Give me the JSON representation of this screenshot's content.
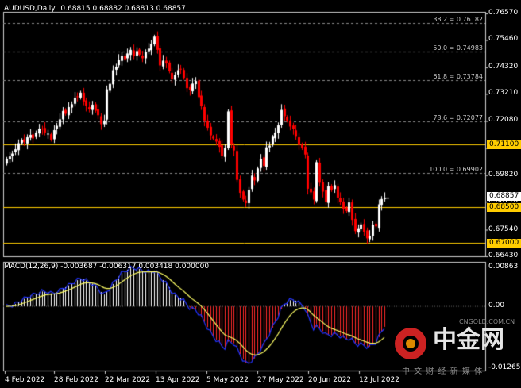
{
  "header": {
    "symbol": "AUDUSD,Daily",
    "ohlc": "0.68815 0.68882 0.68813 0.68857"
  },
  "macd": {
    "label": "MACD(12,26,9) -0.003687 -0.006317 0.003418 0.000000",
    "axis": [
      "0.00863",
      "0.00",
      "-0.012657"
    ]
  },
  "price_axis": [
    "0.76570",
    "0.75460",
    "0.74320",
    "0.73210",
    "0.72080",
    "0.70950",
    "0.69820",
    "0.68710",
    "0.67540",
    "0.66430"
  ],
  "fibo_levels": [
    {
      "text": "38.2 = 0.76182",
      "value": 0.76182
    },
    {
      "text": "50.0 = 0.74983",
      "value": 0.74983
    },
    {
      "text": "61.8 = 0.73784",
      "value": 0.73784
    },
    {
      "text": "78.6 = 0.72077",
      "value": 0.72077
    },
    {
      "text": "100.0 = 0.69902",
      "value": 0.69902
    }
  ],
  "hlines": [
    {
      "text": "0.71100",
      "value": 0.711,
      "color": "#ffcc00"
    },
    {
      "text": "0.68500",
      "value": 0.685,
      "color": "#ffcc00"
    },
    {
      "text": "0.67000",
      "value": 0.67,
      "color": "#ffcc00"
    }
  ],
  "current_price": {
    "text": "0.68857",
    "value": 0.68857
  },
  "date_labels": [
    "4 Feb 2022",
    "28 Feb 2022",
    "22 Mar 2022",
    "13 Apr 2022",
    "5 May 2022",
    "27 May 2022",
    "20 Jun 2022",
    "12 Jul 2022"
  ],
  "colors": {
    "bull": "#ffffff",
    "bear": "#ff0000",
    "signal": "#ffff66",
    "macd_line": "#2233ff",
    "grid": "#888888"
  },
  "watermark": {
    "site": "CNGOLD.COM.CN",
    "cn_logo": "中金网",
    "cn_sub": "中 文 财 经 新 媒 体"
  },
  "chart_data": {
    "type": "candlestick",
    "ylim": [
      0.6643,
      0.7657
    ],
    "close": [
      0.705,
      0.706,
      0.7072,
      0.709,
      0.7115,
      0.7128,
      0.712,
      0.714,
      0.715,
      0.7135,
      0.716,
      0.7176,
      0.7175,
      0.716,
      0.7155,
      0.713,
      0.717,
      0.7188,
      0.7215,
      0.725,
      0.7238,
      0.7266,
      0.7278,
      0.7305,
      0.731,
      0.7326,
      0.729,
      0.7272,
      0.7256,
      0.7276,
      0.7251,
      0.7232,
      0.7195,
      0.721,
      0.734,
      0.7363,
      0.742,
      0.7435,
      0.7463,
      0.748,
      0.7466,
      0.749,
      0.7505,
      0.7478,
      0.75,
      0.7485,
      0.747,
      0.7495,
      0.751,
      0.753,
      0.756,
      0.7505,
      0.744,
      0.746,
      0.7448,
      0.7415,
      0.7382,
      0.74,
      0.742,
      0.7425,
      0.7388,
      0.7345,
      0.7338,
      0.7364,
      0.7375,
      0.7308,
      0.727,
      0.721,
      0.718,
      0.7148,
      0.7135,
      0.7122,
      0.71,
      0.7062,
      0.7095,
      0.7248,
      0.711,
      0.7085,
      0.6962,
      0.6908,
      0.688,
      0.6865,
      0.692,
      0.698,
      0.696,
      0.701,
      0.705,
      0.702,
      0.7098,
      0.7105,
      0.7142,
      0.716,
      0.719,
      0.7254,
      0.7228,
      0.721,
      0.7185,
      0.7175,
      0.7142,
      0.7108,
      0.7095,
      0.7068,
      0.6925,
      0.691,
      0.688,
      0.7036,
      0.695,
      0.6913,
      0.687,
      0.6936,
      0.692,
      0.694,
      0.6888,
      0.687,
      0.684,
      0.6832,
      0.6868,
      0.6795,
      0.6748,
      0.676,
      0.6776,
      0.6745,
      0.6718,
      0.6728,
      0.6775,
      0.6768,
      0.686,
      0.6882,
      0.6886
    ]
  }
}
